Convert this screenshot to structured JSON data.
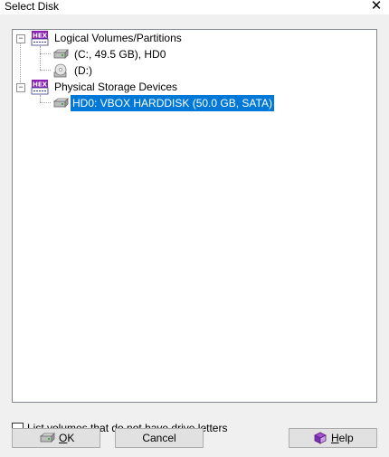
{
  "window": {
    "title": "Select Disk"
  },
  "tree": {
    "groups": [
      {
        "label": "Logical Volumes/Partitions",
        "expander": "−",
        "items": [
          {
            "label": "(C:, 49.5 GB), HD0",
            "icon": "hard-drive-icon"
          },
          {
            "label": "(D:)",
            "icon": "cd-drive-icon"
          }
        ]
      },
      {
        "label": "Physical Storage Devices",
        "expander": "−",
        "items": [
          {
            "label": "HD0: VBOX HARDDISK (50.0 GB, SATA)",
            "icon": "hard-drive-icon",
            "selected": true
          }
        ]
      }
    ],
    "group_icon_text": "HEX"
  },
  "options": {
    "list_volumes_label": "List volumes that do not have drive letters",
    "list_volumes_checked": false
  },
  "buttons": {
    "ok_first": "O",
    "ok_rest": "K",
    "cancel": "Cancel",
    "help_first": "H",
    "help_rest": "elp"
  },
  "colors": {
    "selection": "#0078d7",
    "hex_icon": "#8b1fb5"
  }
}
